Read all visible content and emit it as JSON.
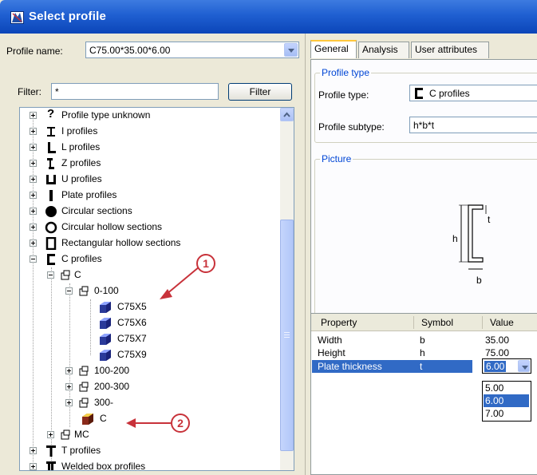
{
  "window": {
    "title": "Select profile"
  },
  "profile": {
    "label": "Profile name:",
    "value": "C75.00*35.00*6.00"
  },
  "filter": {
    "label": "Filter:",
    "value": "*",
    "button": "Filter"
  },
  "tree": {
    "items": [
      {
        "label": "Profile type unknown",
        "icon": "question-icon"
      },
      {
        "label": "I profiles",
        "icon": "i-profile-icon"
      },
      {
        "label": "L profiles",
        "icon": "l-profile-icon"
      },
      {
        "label": "Z profiles",
        "icon": "z-profile-icon"
      },
      {
        "label": "U profiles",
        "icon": "u-profile-icon"
      },
      {
        "label": "Plate profiles",
        "icon": "plate-icon"
      },
      {
        "label": "Circular sections",
        "icon": "circle-filled-icon"
      },
      {
        "label": "Circular hollow sections",
        "icon": "circle-hollow-icon"
      },
      {
        "label": "Rectangular hollow sections",
        "icon": "rect-hollow-icon"
      },
      {
        "label": "C profiles",
        "icon": "c-profile-icon"
      }
    ],
    "c_node": "C",
    "group_0_100": "0-100",
    "leaves": [
      "C75X5",
      "C75X6",
      "C75X7",
      "C75X9"
    ],
    "groups": [
      "100-200",
      "200-300",
      "300-"
    ],
    "user_c": "C",
    "mc": "MC",
    "t_profiles": "T profiles",
    "welded": "Welded box profiles"
  },
  "tabs": [
    "General",
    "Analysis",
    "User attributes"
  ],
  "profile_type": {
    "section_title": "Profile type",
    "type_label": "Profile type:",
    "type_value": "C profiles",
    "subtype_label": "Profile subtype:",
    "subtype_value": "h*b*t"
  },
  "picture": {
    "section_title": "Picture",
    "dim_h": "h",
    "dim_b": "b",
    "dim_t": "t"
  },
  "grid": {
    "headers": [
      "Property",
      "Symbol",
      "Value"
    ],
    "rows": [
      {
        "property": "Width",
        "symbol": "b",
        "value": "35.00"
      },
      {
        "property": "Height",
        "symbol": "h",
        "value": "75.00"
      },
      {
        "property": "Plate thickness",
        "symbol": "t",
        "value": "6.00"
      }
    ],
    "options": [
      "5.00",
      "6.00",
      "7.00"
    ]
  },
  "callouts": [
    "1",
    "2"
  ],
  "colors": {
    "title_bar": "#1f5fd1",
    "selection": "#316ac5",
    "callout": "#c8323a"
  }
}
